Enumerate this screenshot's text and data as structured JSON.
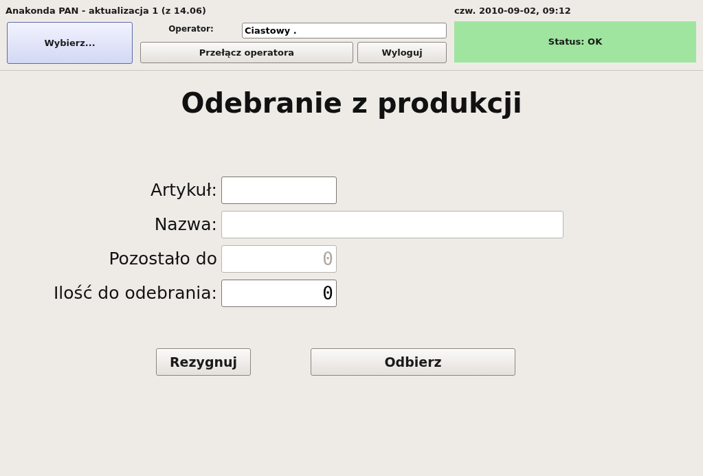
{
  "window": {
    "title": "Anakonda PAN - aktualizacja 1 (z 14.06)"
  },
  "header": {
    "select_button": "Wybierz...",
    "operator_label": "Operator:",
    "operator_value": "Ciastowy .",
    "switch_button": "Przełącz operatora",
    "logout_button": "Wyloguj",
    "datetime": "czw. 2010-09-02, 09:12",
    "status": "Status: OK"
  },
  "heading": "Odebranie z produkcji",
  "fields": [
    {
      "label": "Artykuł:",
      "kind": "short",
      "disabled": false
    },
    {
      "label": "Nazwa:",
      "kind": "long",
      "disabled": true
    },
    {
      "label": "Pozostało do",
      "value": "0",
      "kind": "short",
      "disabled": true
    },
    {
      "label": "Ilość do odebrania:",
      "value": "0",
      "kind": "short",
      "disabled": false
    }
  ],
  "buttons": [
    {
      "label": "Rezygnuj",
      "kind": "narrow"
    },
    {
      "label": "Odbierz",
      "kind": "wide"
    }
  ]
}
